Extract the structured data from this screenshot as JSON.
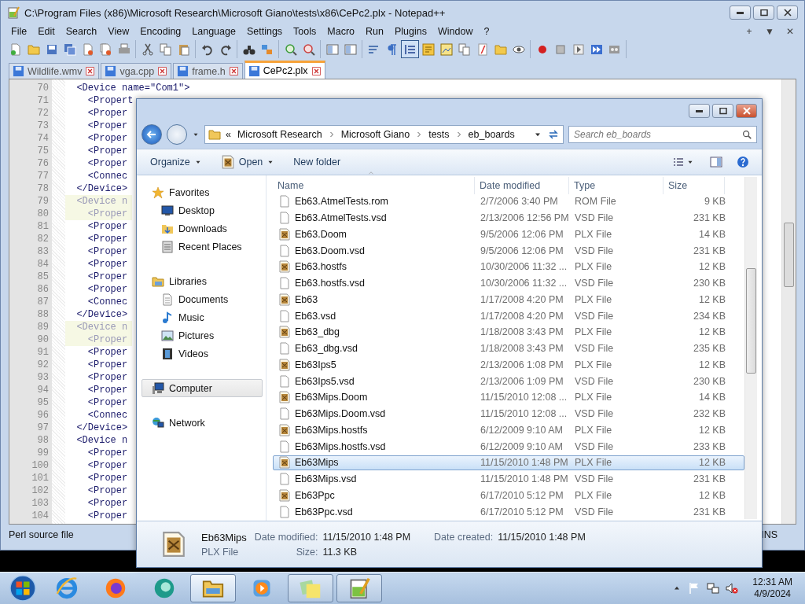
{
  "notepad": {
    "title": "C:\\Program Files (x86)\\Microsoft Research\\Microsoft Giano\\tests\\x86\\CePc2.plx - Notepad++",
    "menu": [
      "File",
      "Edit",
      "Search",
      "View",
      "Encoding",
      "Language",
      "Settings",
      "Tools",
      "Macro",
      "Run",
      "Plugins",
      "Window",
      "?"
    ],
    "menu_controls": [
      "+",
      "▼",
      "✕"
    ],
    "toolbar": [
      [
        {
          "pressed": false
        },
        {
          "pressed": false
        },
        {
          "pressed": false
        },
        {
          "pressed": false
        },
        {
          "pressed": false
        },
        {
          "pressed": false
        },
        {
          "pressed": false
        }
      ],
      [
        {
          "pressed": false
        },
        {
          "pressed": false
        },
        {
          "pressed": false
        }
      ],
      [
        {
          "pressed": false
        },
        {
          "pressed": false
        }
      ],
      [
        {
          "pressed": false
        },
        {
          "pressed": false
        }
      ],
      [
        {
          "pressed": false
        },
        {
          "pressed": false
        }
      ],
      [
        {
          "pressed": false
        },
        {
          "pressed": false
        }
      ],
      [
        {
          "pressed": false
        },
        {
          "pressed": false
        },
        {
          "pressed": true
        },
        {
          "pressed": false
        },
        {
          "pressed": false
        },
        {
          "pressed": false
        },
        {
          "pressed": false
        },
        {
          "pressed": false
        },
        {
          "pressed": false
        }
      ],
      [
        {
          "pressed": false
        },
        {
          "pressed": false
        },
        {
          "pressed": false
        },
        {
          "pressed": false
        },
        {
          "pressed": false
        }
      ]
    ],
    "tabs": [
      {
        "label": "Wildlife.wmv",
        "selected": false
      },
      {
        "label": "vga.cpp",
        "selected": false
      },
      {
        "label": "frame.h",
        "selected": false
      },
      {
        "label": "CePc2.plx",
        "selected": true
      }
    ],
    "lines": [
      {
        "number": "70",
        "text": "  <Device name=\"Com1\">",
        "highlighted": false
      },
      {
        "number": "71",
        "text": "    <Propert",
        "highlighted": false
      },
      {
        "number": "72",
        "text": "    <Proper",
        "highlighted": false
      },
      {
        "number": "73",
        "text": "    <Proper",
        "highlighted": false
      },
      {
        "number": "74",
        "text": "    <Proper",
        "highlighted": false
      },
      {
        "number": "75",
        "text": "    <Proper",
        "highlighted": false
      },
      {
        "number": "76",
        "text": "    <Proper",
        "highlighted": false
      },
      {
        "number": "77",
        "text": "    <Connec",
        "highlighted": false
      },
      {
        "number": "78",
        "text": "  </Device>",
        "highlighted": false
      },
      {
        "number": "79",
        "text": "  <Device n",
        "highlighted": true
      },
      {
        "number": "80",
        "text": "    <Proper",
        "highlighted": true
      },
      {
        "number": "81",
        "text": "    <Proper",
        "highlighted": false
      },
      {
        "number": "82",
        "text": "    <Proper",
        "highlighted": false
      },
      {
        "number": "83",
        "text": "    <Proper",
        "highlighted": false
      },
      {
        "number": "84",
        "text": "    <Proper",
        "highlighted": false
      },
      {
        "number": "85",
        "text": "    <Proper",
        "highlighted": false
      },
      {
        "number": "86",
        "text": "    <Proper",
        "highlighted": false
      },
      {
        "number": "87",
        "text": "    <Connec",
        "highlighted": false
      },
      {
        "number": "88",
        "text": "  </Device>",
        "highlighted": false
      },
      {
        "number": "89",
        "text": "  <Device n",
        "highlighted": true
      },
      {
        "number": "90",
        "text": "    <Proper",
        "highlighted": true
      },
      {
        "number": "91",
        "text": "    <Proper",
        "highlighted": false
      },
      {
        "number": "92",
        "text": "    <Proper",
        "highlighted": false
      },
      {
        "number": "93",
        "text": "    <Proper",
        "highlighted": false
      },
      {
        "number": "94",
        "text": "    <Proper",
        "highlighted": false
      },
      {
        "number": "95",
        "text": "    <Proper",
        "highlighted": false
      },
      {
        "number": "96",
        "text": "    <Connec",
        "highlighted": false
      },
      {
        "number": "97",
        "text": "  </Device>",
        "highlighted": false
      },
      {
        "number": "98",
        "text": "  <Device n",
        "highlighted": false
      },
      {
        "number": "99",
        "text": "    <Proper",
        "highlighted": false
      },
      {
        "number": "100",
        "text": "    <Proper",
        "highlighted": false
      },
      {
        "number": "101",
        "text": "    <Proper",
        "highlighted": false
      },
      {
        "number": "102",
        "text": "    <Proper",
        "highlighted": false
      },
      {
        "number": "103",
        "text": "    <Proper",
        "highlighted": false
      },
      {
        "number": "104",
        "text": "    <Proper",
        "highlighted": false
      }
    ],
    "status_bar": {
      "file_type": "Perl source file",
      "mode": "INS"
    }
  },
  "explorer": {
    "breadcrumb_prefix": "«",
    "breadcrumb": [
      "Microsoft Research",
      "Microsoft Giano",
      "tests",
      "eb_boards"
    ],
    "search": {
      "placeholder": "Search eb_boards"
    },
    "commands": [
      {
        "label": "Organize",
        "dropdown": true
      },
      {
        "label": "Open",
        "dropdown": true
      },
      {
        "label": "New folder",
        "dropdown": false
      }
    ],
    "nav": [
      {
        "label": "Favorites",
        "selected": false,
        "children": [
          {
            "label": "Desktop",
            "selected": false
          },
          {
            "label": "Downloads",
            "selected": false
          },
          {
            "label": "Recent Places",
            "selected": false
          }
        ]
      },
      {
        "label": "Libraries",
        "selected": false,
        "children": [
          {
            "label": "Documents",
            "selected": false
          },
          {
            "label": "Music",
            "selected": false
          },
          {
            "label": "Pictures",
            "selected": false
          },
          {
            "label": "Videos",
            "selected": false
          }
        ]
      },
      {
        "label": "Computer",
        "selected": true
      },
      {
        "label": "Network",
        "selected": false
      }
    ],
    "columns": [
      "Name",
      "Date modified",
      "Type",
      "Size"
    ],
    "files": [
      {
        "name": "Eb63.AtmelTests.rom",
        "date": "2/7/2006 3:40 PM",
        "type": "ROM File",
        "size": "9 KB",
        "kind": "blank",
        "selected": false
      },
      {
        "name": "Eb63.AtmelTests.vsd",
        "date": "2/13/2006 12:56 PM",
        "type": "VSD File",
        "size": "231 KB",
        "kind": "blank",
        "selected": false
      },
      {
        "name": "Eb63.Doom",
        "date": "9/5/2006 12:06 PM",
        "type": "PLX File",
        "size": "14 KB",
        "kind": "plx",
        "selected": false
      },
      {
        "name": "Eb63.Doom.vsd",
        "date": "9/5/2006 12:06 PM",
        "type": "VSD File",
        "size": "231 KB",
        "kind": "blank",
        "selected": false
      },
      {
        "name": "Eb63.hostfs",
        "date": "10/30/2006 11:32 ...",
        "type": "PLX File",
        "size": "12 KB",
        "kind": "plx",
        "selected": false
      },
      {
        "name": "Eb63.hostfs.vsd",
        "date": "10/30/2006 11:32 ...",
        "type": "VSD File",
        "size": "230 KB",
        "kind": "blank",
        "selected": false
      },
      {
        "name": "Eb63",
        "date": "1/17/2008 4:20 PM",
        "type": "PLX File",
        "size": "12 KB",
        "kind": "plx",
        "selected": false
      },
      {
        "name": "Eb63.vsd",
        "date": "1/17/2008 4:20 PM",
        "type": "VSD File",
        "size": "234 KB",
        "kind": "blank",
        "selected": false
      },
      {
        "name": "Eb63_dbg",
        "date": "1/18/2008 3:43 PM",
        "type": "PLX File",
        "size": "12 KB",
        "kind": "plx",
        "selected": false
      },
      {
        "name": "Eb63_dbg.vsd",
        "date": "1/18/2008 3:43 PM",
        "type": "VSD File",
        "size": "235 KB",
        "kind": "blank",
        "selected": false
      },
      {
        "name": "Eb63Ips5",
        "date": "2/13/2006 1:08 PM",
        "type": "PLX File",
        "size": "12 KB",
        "kind": "plx",
        "selected": false
      },
      {
        "name": "Eb63Ips5.vsd",
        "date": "2/13/2006 1:09 PM",
        "type": "VSD File",
        "size": "230 KB",
        "kind": "blank",
        "selected": false
      },
      {
        "name": "Eb63Mips.Doom",
        "date": "11/15/2010 12:08 ...",
        "type": "PLX File",
        "size": "14 KB",
        "kind": "plx",
        "selected": false
      },
      {
        "name": "Eb63Mips.Doom.vsd",
        "date": "11/15/2010 12:08 ...",
        "type": "VSD File",
        "size": "232 KB",
        "kind": "blank",
        "selected": false
      },
      {
        "name": "Eb63Mips.hostfs",
        "date": "6/12/2009 9:10 AM",
        "type": "PLX File",
        "size": "12 KB",
        "kind": "plx",
        "selected": false
      },
      {
        "name": "Eb63Mips.hostfs.vsd",
        "date": "6/12/2009 9:10 AM",
        "type": "VSD File",
        "size": "233 KB",
        "kind": "blank",
        "selected": false
      },
      {
        "name": "Eb63Mips",
        "date": "11/15/2010 1:48 PM",
        "type": "PLX File",
        "size": "12 KB",
        "kind": "plx",
        "selected": true
      },
      {
        "name": "Eb63Mips.vsd",
        "date": "11/15/2010 1:48 PM",
        "type": "VSD File",
        "size": "231 KB",
        "kind": "blank",
        "selected": false
      },
      {
        "name": "Eb63Ppc",
        "date": "6/17/2010 5:12 PM",
        "type": "PLX File",
        "size": "12 KB",
        "kind": "plx",
        "selected": false
      },
      {
        "name": "Eb63Ppc.vsd",
        "date": "6/17/2010 5:12 PM",
        "type": "VSD File",
        "size": "231 KB",
        "kind": "blank",
        "selected": false
      }
    ],
    "details": {
      "name": "Eb63Mips",
      "type": "PLX File",
      "fields": [
        {
          "label": "Date modified:",
          "value": "11/15/2010 1:48 PM"
        },
        {
          "label": "Date created:",
          "value": "11/15/2010 1:48 PM"
        },
        {
          "label": "Size:",
          "value": "11.3 KB"
        }
      ]
    }
  },
  "taskbar": {
    "apps": [
      {
        "open": false,
        "active": false
      },
      {
        "open": false,
        "active": false
      },
      {
        "open": false,
        "active": false
      },
      {
        "open": true,
        "active": true
      },
      {
        "open": false,
        "active": false
      },
      {
        "open": true,
        "active": false
      },
      {
        "open": true,
        "active": false
      }
    ],
    "time": "12:31 AM",
    "date": "4/9/2024"
  }
}
